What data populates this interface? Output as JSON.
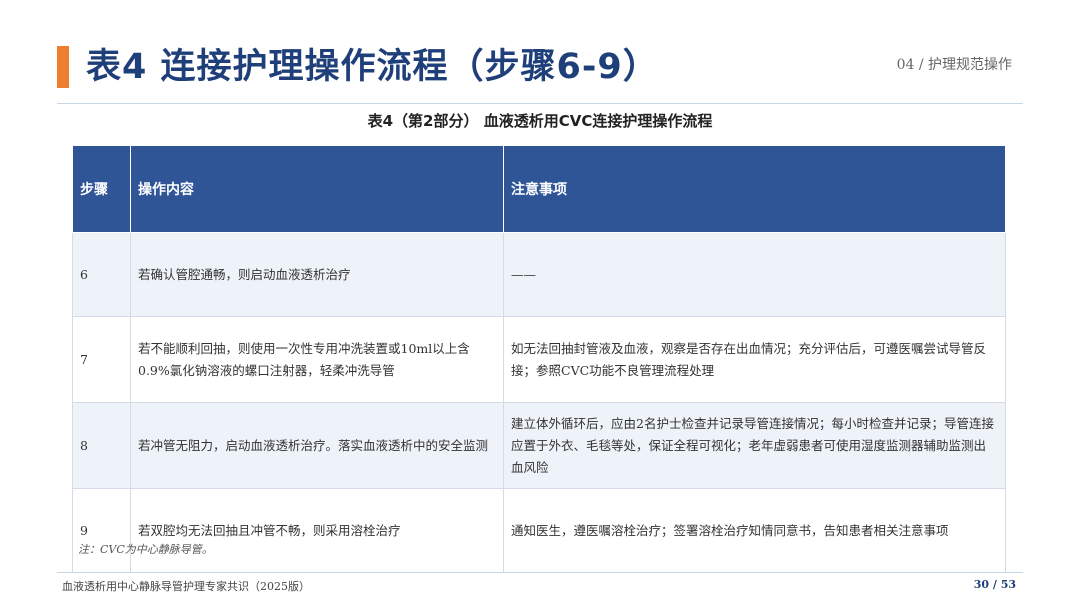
{
  "header": {
    "title": "表4  连接护理操作流程（步骤6-9）",
    "section_label": "04 / 护理规范操作",
    "accent_color": "#ee7d2f"
  },
  "table": {
    "caption": "表4（第2部分）  血液透析用CVC连接护理操作流程",
    "header_color": "#2f5597",
    "columns": [
      "步骤",
      "操作内容",
      "注意事项"
    ],
    "rows": [
      {
        "step": "6",
        "content": "若确认管腔通畅，则启动血液透析治疗",
        "notes": "——"
      },
      {
        "step": "7",
        "content": "若不能顺利回抽，则使用一次性专用冲洗装置或10ml以上含0.9%氯化钠溶液的螺口注射器，轻柔冲洗导管",
        "notes": "如无法回抽封管液及血液，观察是否存在出血情况；充分评估后，可遵医嘱尝试导管反接；参照CVC功能不良管理流程处理"
      },
      {
        "step": "8",
        "content": "若冲管无阻力，启动血液透析治疗。落实血液透析中的安全监测",
        "notes": "建立体外循环后，应由2名护士检查并记录导管连接情况；每小时检查并记录；导管连接应置于外衣、毛毯等处，保证全程可视化；老年虚弱患者可使用湿度监测器辅助监测出血风险"
      },
      {
        "step": "9",
        "content": "若双腔均无法回抽且冲管不畅，则采用溶栓治疗",
        "notes": "通知医生，遵医嘱溶栓治疗；签署溶栓治疗知情同意书，告知患者相关注意事项"
      }
    ],
    "note": "注：CVC为中心静脉导管。"
  },
  "footer": {
    "document_name": "血液透析用中心静脉导管护理专家共识（2025版）",
    "page": "30 / 53"
  }
}
